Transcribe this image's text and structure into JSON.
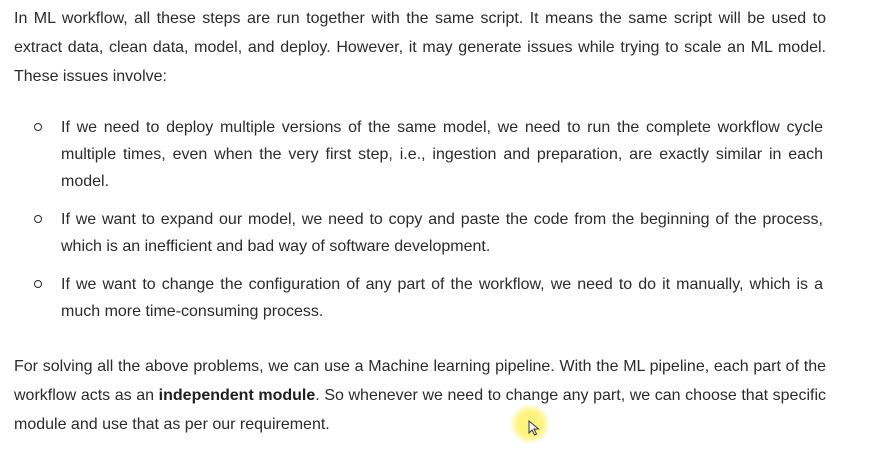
{
  "intro": {
    "text": "In ML workflow, all these steps are run together with the same script. It means the same script will be used to extract data, clean data, model, and deploy. However, it may generate issues while trying to scale an ML model. These issues involve:"
  },
  "issues": [
    {
      "text": "If we need to deploy multiple versions of the same model, we need to run the complete workflow cycle multiple times, even when the very first step, i.e., ingestion and preparation, are exactly similar in each model."
    },
    {
      "text": "If we want to expand our model, we need to copy and paste the code from the beginning of the process, which is an inefficient and bad way of software development."
    },
    {
      "text": "If we want to change the configuration of any part of the workflow, we need to do it manually, which is a much more time-consuming process."
    }
  ],
  "conclusion": {
    "before": "For solving all the above problems, we can use a Machine learning pipeline. With the ML pipeline, each part of the workflow acts as an ",
    "bold": "independent module",
    "after": ". So whenever we need to change any part, we can choose that specific module and use that as per our requirement."
  },
  "icons": {
    "bullet": "hollow-circle-bullet-icon",
    "cursor": "mouse-pointer-icon",
    "cursor_highlight_color": "#fff15a"
  }
}
